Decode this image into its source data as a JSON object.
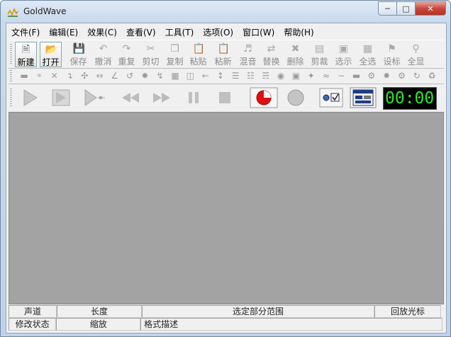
{
  "window": {
    "title": "GoldWave",
    "accent": "#c7483a",
    "frame": "#bfd2e8"
  },
  "menu": [
    "文件(F)",
    "编辑(E)",
    "效果(C)",
    "查看(V)",
    "工具(T)",
    "选项(O)",
    "窗口(W)",
    "帮助(H)"
  ],
  "toolbar": {
    "buttons": [
      {
        "label": "新建",
        "icon": "new-file-icon",
        "enabled": true
      },
      {
        "label": "打开",
        "icon": "open-folder-icon",
        "enabled": true
      },
      {
        "label": "保存",
        "icon": "save-disk-icon",
        "enabled": false
      },
      {
        "label": "撤消",
        "icon": "undo-icon",
        "enabled": false
      },
      {
        "label": "重复",
        "icon": "redo-icon",
        "enabled": false
      },
      {
        "label": "剪切",
        "icon": "cut-scissors-icon",
        "enabled": false
      },
      {
        "label": "复制",
        "icon": "copy-icon",
        "enabled": false
      },
      {
        "label": "粘贴",
        "icon": "paste-icon",
        "enabled": false
      },
      {
        "label": "粘新",
        "icon": "paste-new-icon",
        "enabled": false
      },
      {
        "label": "混音",
        "icon": "mix-icon",
        "enabled": false
      },
      {
        "label": "替换",
        "icon": "replace-icon",
        "enabled": false
      },
      {
        "label": "删除",
        "icon": "delete-icon",
        "enabled": false
      },
      {
        "label": "剪裁",
        "icon": "trim-icon",
        "enabled": false
      },
      {
        "label": "选示",
        "icon": "select-view-icon",
        "enabled": false
      },
      {
        "label": "全选",
        "icon": "select-all-icon",
        "enabled": false
      },
      {
        "label": "设标",
        "icon": "set-marker-icon",
        "enabled": false
      },
      {
        "label": "全显",
        "icon": "zoom-all-icon",
        "enabled": false
      }
    ]
  },
  "effects_toolbar": {
    "icons": [
      "effect-doppler-icon",
      "effect-echo-icon",
      "effect-fade-icon",
      "effect-invert-icon",
      "effect-mechanize-icon",
      "effect-offset-icon",
      "effect-pan-icon",
      "effect-pitch-icon",
      "effect-reverb-icon",
      "effect-reverse-icon",
      "effect-equalizer-icon",
      "effect-filter-icon",
      "effect-shift-icon",
      "effect-volume-icon",
      "effect-compressor-icon",
      "effect-match-icon",
      "effect-noise-icon",
      "effect-resample-icon",
      "effect-silence-icon",
      "effect-stereo-icon",
      "effect-time-icon",
      "effect-trim-icon",
      "effect-wave-icon",
      "effect-spectrum-icon",
      "effect-tone-icon",
      "effect-gear-icon",
      "effect-settings-icon",
      "effect-loop-icon"
    ]
  },
  "transport": {
    "buttons": [
      "play-icon",
      "play-selection-icon",
      "play-from-cursor-icon",
      "rewind-icon",
      "fast-forward-icon",
      "pause-icon",
      "stop-icon",
      "record-icon",
      "record-pause-icon"
    ],
    "record_color": "#e01010",
    "time_display": "00:00:",
    "time_color": "#29e629"
  },
  "status": {
    "row1": [
      "声道",
      "长度",
      "选定部分范围",
      "回放光标"
    ],
    "row2": [
      "修改状态",
      "缩放",
      "格式描述"
    ]
  }
}
